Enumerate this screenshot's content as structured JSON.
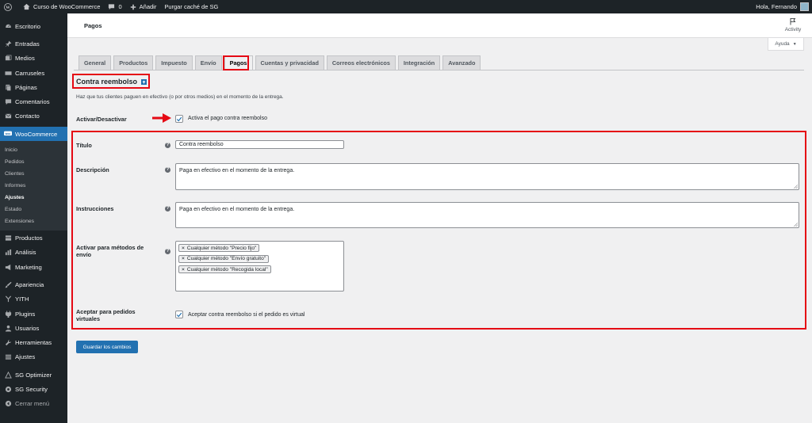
{
  "adminbar": {
    "site_name": "Curso de WooCommerce",
    "comments_count": "0",
    "add_new": "Añadir",
    "purge_cache": "Purgar caché de SG",
    "greeting": "Hola, Fernando"
  },
  "sidebar": {
    "items_top": [
      {
        "label": "Escritorio",
        "icon": "dashboard-icon"
      },
      {
        "label": "Entradas",
        "icon": "pin-icon"
      },
      {
        "label": "Medios",
        "icon": "media-icon"
      },
      {
        "label": "Carruseles",
        "icon": "carousel-icon"
      },
      {
        "label": "Páginas",
        "icon": "pages-icon"
      },
      {
        "label": "Comentarios",
        "icon": "comments-icon"
      },
      {
        "label": "Contacto",
        "icon": "mail-icon"
      }
    ],
    "woocommerce": "WooCommerce",
    "submenu": [
      "Inicio",
      "Pedidos",
      "Clientes",
      "Informes",
      "Ajustes",
      "Estado",
      "Extensiones"
    ],
    "submenu_current": "Ajustes",
    "items_bottom": [
      {
        "label": "Productos",
        "icon": "products-icon"
      },
      {
        "label": "Análisis",
        "icon": "chart-icon"
      },
      {
        "label": "Marketing",
        "icon": "megaphone-icon"
      },
      {
        "label": "Apariencia",
        "icon": "brush-icon"
      },
      {
        "label": "YITH",
        "icon": "yith-icon"
      },
      {
        "label": "Plugins",
        "icon": "plugin-icon"
      },
      {
        "label": "Usuarios",
        "icon": "user-icon"
      },
      {
        "label": "Herramientas",
        "icon": "wrench-icon"
      },
      {
        "label": "Ajustes",
        "icon": "settings-icon"
      },
      {
        "label": "SG Optimizer",
        "icon": "optimizer-icon"
      },
      {
        "label": "SG Security",
        "icon": "security-icon"
      },
      {
        "label": "Cerrar menú",
        "icon": "collapse-icon"
      }
    ]
  },
  "header": {
    "title": "Pagos",
    "activity": "Activity",
    "help": "Ayuda"
  },
  "tabs": [
    "General",
    "Productos",
    "Impuesto",
    "Envío",
    "Pagos",
    "Cuentas y privacidad",
    "Correos electrónicos",
    "Integración",
    "Avanzado"
  ],
  "active_tab": "Pagos",
  "section": {
    "title": "Contra reembolso",
    "description": "Haz que tus clientes paguen en efectivo (o por otros medios) en el momento de la entrega."
  },
  "form": {
    "enable_label": "Activar/Desactivar",
    "enable_checkbox_label": "Activa el pago contra reembolso",
    "title_label": "Título",
    "title_value": "Contra reembolso",
    "description_label": "Descripción",
    "description_value": "Paga en efectivo en el momento de la entrega.",
    "instructions_label": "Instrucciones",
    "instructions_value": "Paga en efectivo en el momento de la entrega.",
    "shipping_label": "Activar para métodos de envío",
    "shipping_methods": [
      "Cualquier método \"Precio fijo\"",
      "Cualquier método \"Envío gratuito\"",
      "Cualquier método \"Recogida local\""
    ],
    "virtual_label": "Aceptar para pedidos virtuales",
    "virtual_checkbox_label": "Aceptar contra reembolso si el pedido es virtual",
    "help_tip": "?"
  },
  "save_button": "Guardar los cambios",
  "colors": {
    "admin_dark": "#1d2327",
    "accent_blue": "#2271b1",
    "annotation_red": "#e50914"
  }
}
